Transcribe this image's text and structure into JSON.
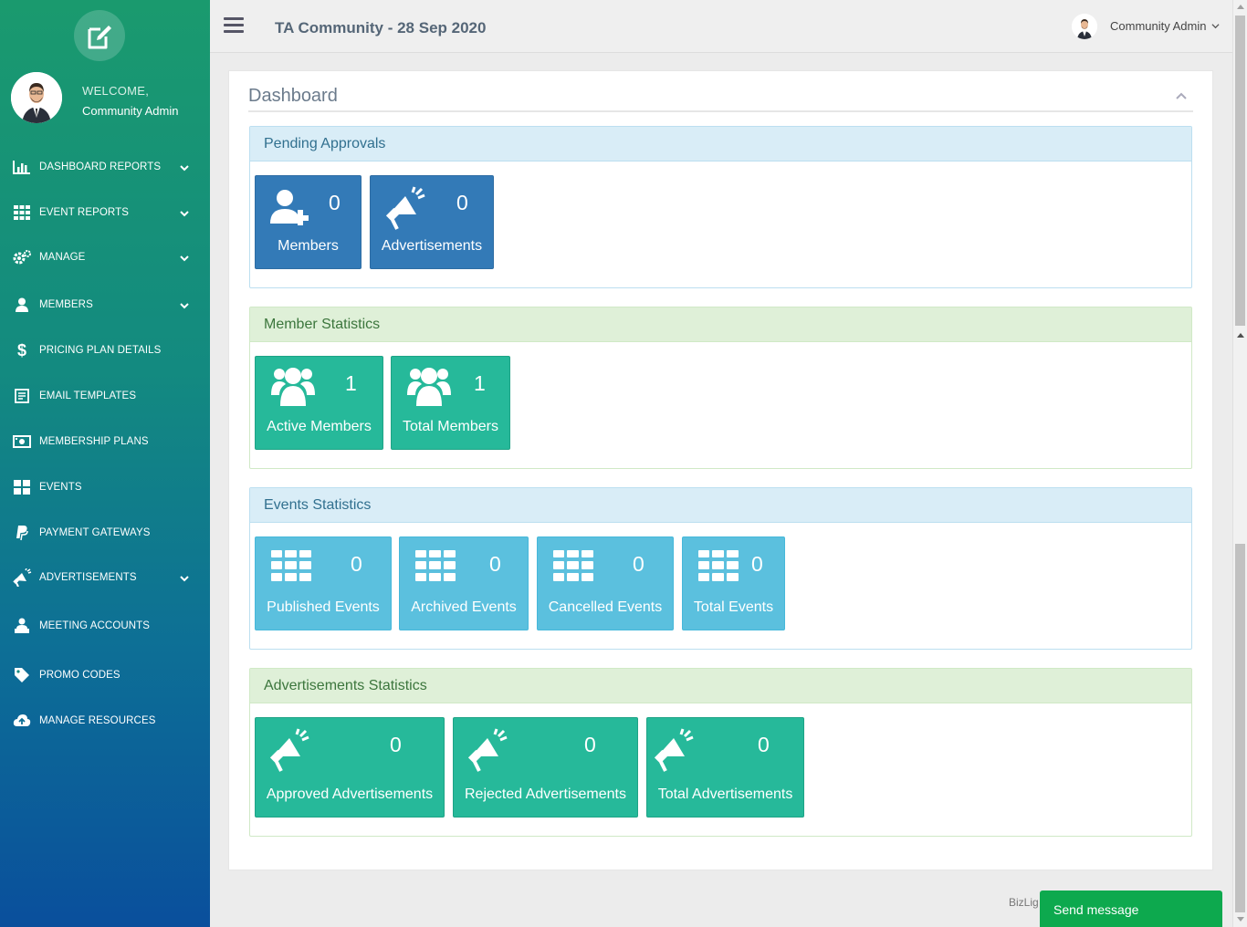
{
  "sidebar": {
    "welcome": "WELCOME,",
    "user_name": "Community Admin",
    "items": [
      {
        "label": "DASHBOARD REPORTS",
        "icon": "bar-chart-icon",
        "has_children": true
      },
      {
        "label": "EVENT REPORTS",
        "icon": "grid-table-icon",
        "has_children": true
      },
      {
        "label": "MANAGE",
        "icon": "gears-icon",
        "has_children": true
      },
      {
        "label": "MEMBERS",
        "icon": "user-icon",
        "has_children": true
      },
      {
        "label": "PRICING PLAN DETAILS",
        "icon": "dollar-icon",
        "has_children": false
      },
      {
        "label": "EMAIL TEMPLATES",
        "icon": "template-icon",
        "has_children": false
      },
      {
        "label": "MEMBERSHIP PLANS",
        "icon": "money-icon",
        "has_children": false
      },
      {
        "label": "EVENTS",
        "icon": "th-large-icon",
        "has_children": false
      },
      {
        "label": "PAYMENT GATEWAYS",
        "icon": "paypal-icon",
        "has_children": false
      },
      {
        "label": "ADVERTISEMENTS",
        "icon": "bullhorn-icon",
        "has_children": true
      },
      {
        "label": "MEETING ACCOUNTS",
        "icon": "user-desk-icon",
        "has_children": false
      },
      {
        "label": "PROMO CODES",
        "icon": "tag-icon",
        "has_children": false
      },
      {
        "label": "MANAGE RESOURCES",
        "icon": "cloud-upload-icon",
        "has_children": false
      }
    ]
  },
  "topbar": {
    "title": "TA Community - 28 Sep 2020",
    "user_name": "Community Admin"
  },
  "panel": {
    "title": "Dashboard"
  },
  "sections": {
    "pending": {
      "title": "Pending Approvals",
      "tiles": [
        {
          "count": "0",
          "label": "Members",
          "icon": "user-plus-icon"
        },
        {
          "count": "0",
          "label": "Advertisements",
          "icon": "bullhorn-icon"
        }
      ]
    },
    "members": {
      "title": "Member Statistics",
      "tiles": [
        {
          "count": "1",
          "label": "Active Members",
          "icon": "users-icon"
        },
        {
          "count": "1",
          "label": "Total Members",
          "icon": "users-icon"
        }
      ]
    },
    "events": {
      "title": "Events Statistics",
      "tiles": [
        {
          "count": "0",
          "label": "Published Events",
          "icon": "th-icon"
        },
        {
          "count": "0",
          "label": "Archived Events",
          "icon": "th-icon"
        },
        {
          "count": "0",
          "label": "Cancelled Events",
          "icon": "th-icon"
        },
        {
          "count": "0",
          "label": "Total Events",
          "icon": "th-icon"
        }
      ]
    },
    "ads": {
      "title": "Advertisements Statistics",
      "tiles": [
        {
          "count": "0",
          "label": "Approved Advertisements",
          "icon": "bullhorn-icon"
        },
        {
          "count": "0",
          "label": "Rejected Advertisements",
          "icon": "bullhorn-icon"
        },
        {
          "count": "0",
          "label": "Total Advertisements",
          "icon": "bullhorn-icon"
        }
      ]
    }
  },
  "footer": {
    "brand_partial": "BizLig",
    "send_message": "Send message"
  },
  "colors": {
    "tile_dark_blue": "#337ab7",
    "tile_teal": "#26b99a",
    "tile_sky": "#5bc0de",
    "send_button": "#0da94e"
  }
}
